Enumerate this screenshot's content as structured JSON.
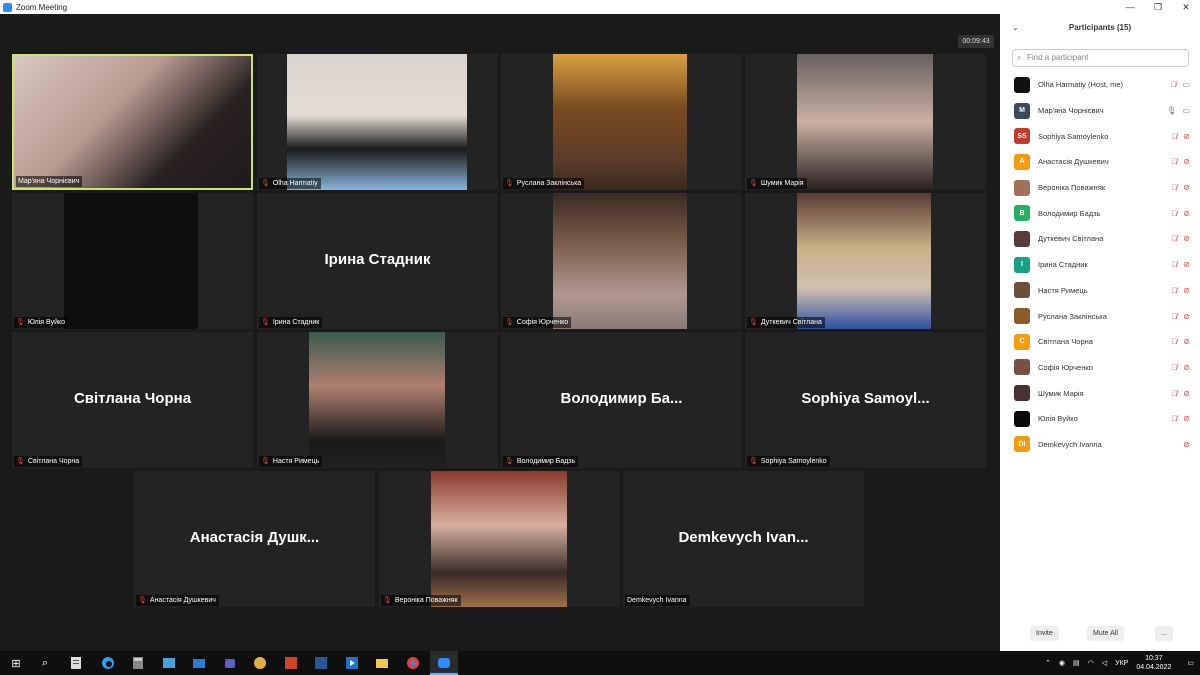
{
  "window": {
    "title": "Zoom Meeting",
    "controls": [
      "—",
      "❐",
      "✕"
    ]
  },
  "meeting": {
    "timer": "00:09:43"
  },
  "tiles": [
    {
      "label": "Мар'яна Чорнієвич",
      "muted": false,
      "speaking": true,
      "video": true
    },
    {
      "label": "Olha Harmatiy",
      "muted": true,
      "video": true
    },
    {
      "label": "Руслана Заклінська",
      "muted": true,
      "video": true
    },
    {
      "label": "Шумик Марія",
      "muted": true,
      "video": true
    },
    {
      "label": "Юлія Вуйко",
      "muted": true,
      "video": true
    },
    {
      "label": "Ірина Стадник",
      "muted": true,
      "video": false,
      "big_name": "Ірина Стадник"
    },
    {
      "label": "Софія Юрченко",
      "muted": true,
      "video": true
    },
    {
      "label": "Дуткевич Світлана",
      "muted": true,
      "video": true
    },
    {
      "label": "Світлана Чорна",
      "muted": true,
      "video": false,
      "big_name": "Світлана Чорна"
    },
    {
      "label": "Настя Римець",
      "muted": true,
      "video": true
    },
    {
      "label": "Володимир Бадзь",
      "muted": true,
      "video": false,
      "big_name": "Володимир Ба..."
    },
    {
      "label": "Sophiya Samoylenko",
      "muted": true,
      "video": false,
      "big_name": "Sophiya Samoyl..."
    },
    {
      "label": "Анастасія Душкевич",
      "muted": true,
      "video": false,
      "big_name": "Анастасія Душк..."
    },
    {
      "label": "Вероніка Поважняк",
      "muted": true,
      "video": true
    },
    {
      "label": "Demkevych Ivanna",
      "muted": false,
      "video": false,
      "big_name": "Demkevych Ivan..."
    }
  ],
  "panel": {
    "title": "Participants (15)",
    "collapse_icon": "⌄",
    "search_placeholder": "Find a participant",
    "participants": [
      {
        "name": "Olha Harmatiy (Host, me)",
        "initials": "",
        "color": "#111111",
        "mic": "off",
        "cam": "on"
      },
      {
        "name": "Мар'яна Чорнієвич",
        "initials": "M",
        "color": "#3a4a5c",
        "mic": "on",
        "cam": "on"
      },
      {
        "name": "Sophiya Samoylenko",
        "initials": "SS",
        "color": "#c0392b",
        "mic": "off",
        "cam": "off"
      },
      {
        "name": "Анастасія Душкевич",
        "initials": "A",
        "color": "#f39c12",
        "mic": "off",
        "cam": "off"
      },
      {
        "name": "Вероніка Поважняк",
        "initials": "",
        "color": "#a0705a",
        "mic": "off",
        "cam": "off"
      },
      {
        "name": "Володимир Бадзь",
        "initials": "B",
        "color": "#27ae60",
        "mic": "off",
        "cam": "off"
      },
      {
        "name": "Дуткевич Світлана",
        "initials": "",
        "color": "#5a3a3a",
        "mic": "off",
        "cam": "off"
      },
      {
        "name": "Ірина Стадник",
        "initials": "I",
        "color": "#16a085",
        "mic": "off",
        "cam": "off"
      },
      {
        "name": "Настя Римець",
        "initials": "",
        "color": "#6b4f3a",
        "mic": "off",
        "cam": "off"
      },
      {
        "name": "Руслана Заклінська",
        "initials": "",
        "color": "#8a5a2a",
        "mic": "off",
        "cam": "off"
      },
      {
        "name": "Світлана Чорна",
        "initials": "C",
        "color": "#f39c12",
        "mic": "off",
        "cam": "off"
      },
      {
        "name": "Софія Юрченко",
        "initials": "",
        "color": "#7a5040",
        "mic": "off",
        "cam": "off"
      },
      {
        "name": "Шумик Марія",
        "initials": "",
        "color": "#4a3030",
        "mic": "off",
        "cam": "off"
      },
      {
        "name": "Юлія Вуйко",
        "initials": "",
        "color": "#0a0a0a",
        "mic": "off",
        "cam": "off"
      },
      {
        "name": "Demkevych Ivanna",
        "initials": "DI",
        "color": "#f39c12",
        "mic": "none",
        "cam": "off"
      }
    ],
    "invite_label": "Invite",
    "mute_all_label": "Mute All",
    "more_label": "..."
  },
  "taskbar": {
    "language": "УКР",
    "time": "10:37",
    "date": "04.04.2022"
  }
}
